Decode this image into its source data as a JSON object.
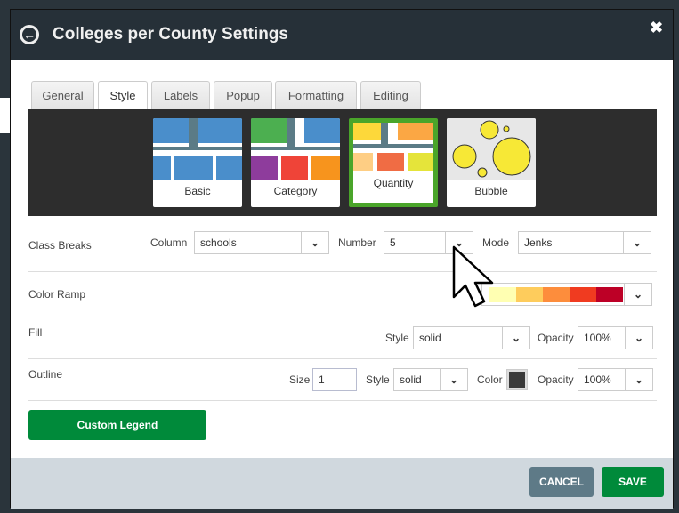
{
  "header": {
    "title": "Colleges per County Settings",
    "back_icon": "back-arrow-circle-icon",
    "close_icon": "close-icon",
    "close_symbol": "✖"
  },
  "tabs": [
    {
      "label": "General"
    },
    {
      "label": "Style",
      "active": true
    },
    {
      "label": "Labels"
    },
    {
      "label": "Popup"
    },
    {
      "label": "Formatting"
    },
    {
      "label": "Editing"
    }
  ],
  "style_types": [
    {
      "label": "Basic"
    },
    {
      "label": "Category"
    },
    {
      "label": "Quantity",
      "selected": true
    },
    {
      "label": "Bubble"
    }
  ],
  "class_breaks": {
    "label": "Class Breaks",
    "column_label": "Column",
    "column_value": "schools",
    "number_label": "Number",
    "number_value": "5",
    "mode_label": "Mode",
    "mode_value": "Jenks"
  },
  "color_ramp": {
    "label": "Color Ramp",
    "colors": [
      "#ffffb2",
      "#fecc5c",
      "#fd8d3c",
      "#f03b20",
      "#bd0026"
    ]
  },
  "fill": {
    "label": "Fill",
    "style_label": "Style",
    "style_value": "solid",
    "opacity_label": "Opacity",
    "opacity_value": "100%"
  },
  "outline": {
    "label": "Outline",
    "size_label": "Size",
    "size_value": "1",
    "style_label": "Style",
    "style_value": "solid",
    "color_label": "Color",
    "color_value": "#3a3a3a",
    "opacity_label": "Opacity",
    "opacity_value": "100%"
  },
  "custom_legend_label": "Custom Legend",
  "footer": {
    "cancel_label": "CANCEL",
    "save_label": "SAVE"
  },
  "colors": {
    "accent_green": "#008a3a",
    "selected_border": "#4aa52a",
    "cancel": "#5e7a87",
    "header": "#263038"
  }
}
